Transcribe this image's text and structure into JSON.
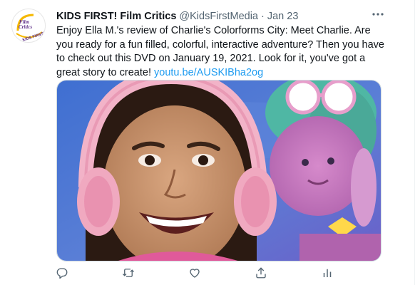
{
  "tweet": {
    "author_name": "KIDS FIRST! Film Critics",
    "author_handle": "@KidsFirstMedia",
    "separator": "·",
    "timestamp": "Jan 23",
    "text": "Enjoy Ella M.'s review of Charlie's Colorforms City: Meet Charlie. Are you ready for a fun filled, colorful, interactive adventure? Then you have to check out this DVD on January 19, 2021. Look for it, you've got a great story to create! ",
    "link": "youtu.be/AUSKIBha2og"
  },
  "avatar": {
    "logo_line1": "Film",
    "logo_line2": "Critics",
    "logo_arc": "KIDS FIRST!"
  },
  "icons": {
    "more": "more-horizontal-icon",
    "reply": "reply-icon",
    "retweet": "retweet-icon",
    "like": "like-icon",
    "share": "share-icon",
    "analytics": "analytics-icon"
  },
  "colors": {
    "text": "#0f1419",
    "secondary": "#536471",
    "link": "#1d9bf0",
    "logo_purple": "#5b2a86",
    "logo_yellow": "#f5b800"
  }
}
